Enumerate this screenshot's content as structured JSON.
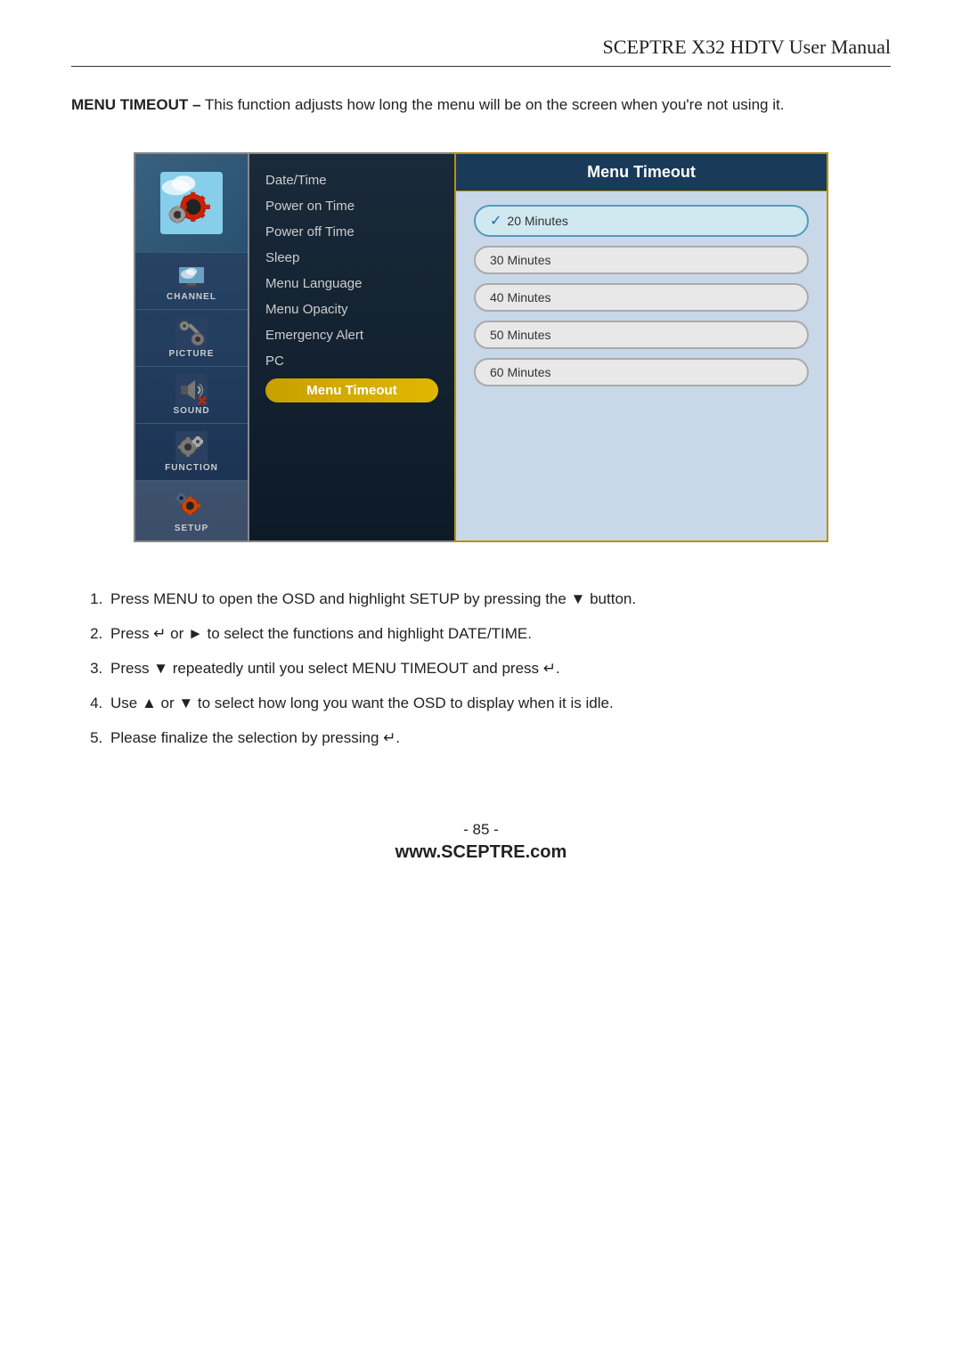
{
  "header": {
    "title": "SCEPTRE X32 HDTV User Manual"
  },
  "intro": {
    "bold": "MENU TIMEOUT –",
    "text": " This function adjusts how long the menu will be on the screen when you're not using it."
  },
  "osd": {
    "sidebar": {
      "items": [
        {
          "label": "CHANNEL",
          "icon": "📺"
        },
        {
          "label": "PICTURE",
          "icon": "🖼️"
        },
        {
          "label": "SOUND",
          "icon": "🔊"
        },
        {
          "label": "FUNCTION",
          "icon": "⚙️"
        },
        {
          "label": "SETUP",
          "icon": "⚙️",
          "active": true
        }
      ]
    },
    "center_menu": {
      "items": [
        {
          "label": "Date/Time"
        },
        {
          "label": "Power on Time"
        },
        {
          "label": "Power off Time"
        },
        {
          "label": "Sleep"
        },
        {
          "label": "Menu Language"
        },
        {
          "label": "Menu Opacity"
        },
        {
          "label": "Emergency Alert"
        },
        {
          "label": "PC"
        },
        {
          "label": "Menu Timeout",
          "active": true
        }
      ]
    },
    "right_panel": {
      "title": "Menu Timeout",
      "options": [
        {
          "label": "20 Minutes",
          "selected": true
        },
        {
          "label": "30 Minutes",
          "selected": false
        },
        {
          "label": "40 Minutes",
          "selected": false
        },
        {
          "label": "50 Minutes",
          "selected": false
        },
        {
          "label": "60 Minutes",
          "selected": false
        }
      ]
    }
  },
  "instructions": {
    "items": [
      "Press MENU to open the OSD and highlight SETUP by pressing the ▼ button.",
      "Press ↵ or ► to select the functions and highlight DATE/TIME.",
      "Press ▼ repeatedly until you select MENU TIMEOUT and press ↵.",
      "Use ▲ or ▼ to select how long you want the OSD to display when it is idle.",
      "Please finalize the selection by pressing ↵."
    ]
  },
  "footer": {
    "page_number": "- 85 -",
    "website": "www.SCEPTRE.com"
  }
}
